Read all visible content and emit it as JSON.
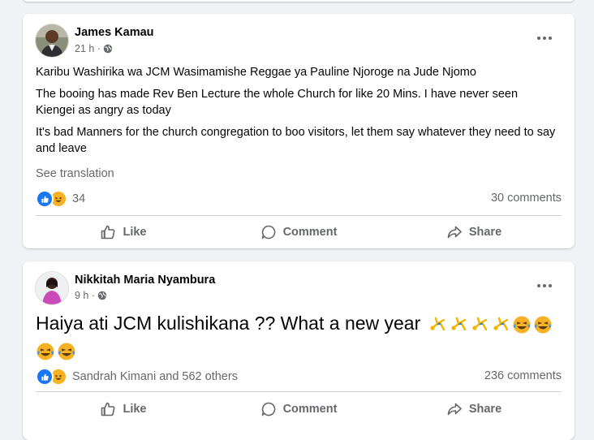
{
  "posts": [
    {
      "author": "James Kamau",
      "time": "21 h ·",
      "paragraphs": [
        "Karibu Washirika wa JCM Wasimamishe Reggae ya Pauline Njoroge na Jude Njomo",
        "The booing has made Rev Ben Lecture the whole Church for like 20 Mins. I have never seen Kiengei as angry as today",
        "It's bad Manners for the church congregation to boo visitors, let them say whatever they need to say and leave"
      ],
      "see_translation": "See translation",
      "reaction_count": "34",
      "comments": "30 comments"
    },
    {
      "author": "Nikkitah Maria Nyambura",
      "time": "9 h ·",
      "text": "Haiya ati JCM kulishikana ?? What a new year",
      "reaction_summary": "Sandrah Kimani and 562 others",
      "comments": "236 comments"
    }
  ],
  "actions": {
    "like": "Like",
    "comment": "Comment",
    "share": "Share"
  },
  "icons": {
    "more": "more-dots-icon",
    "privacy": "globe-icon",
    "like_reaction": "like-reaction-icon",
    "haha_reaction": "haha-reaction-icon",
    "cartwheel": "person-cartwheeling-emoji",
    "laughing": "crying-laughing-emoji"
  },
  "colors": {
    "background": "#f0f2f5",
    "card": "#ffffff",
    "secondary_text": "#65676b",
    "like_blue": "#1877f2",
    "haha_yellow": "#f7b125"
  }
}
